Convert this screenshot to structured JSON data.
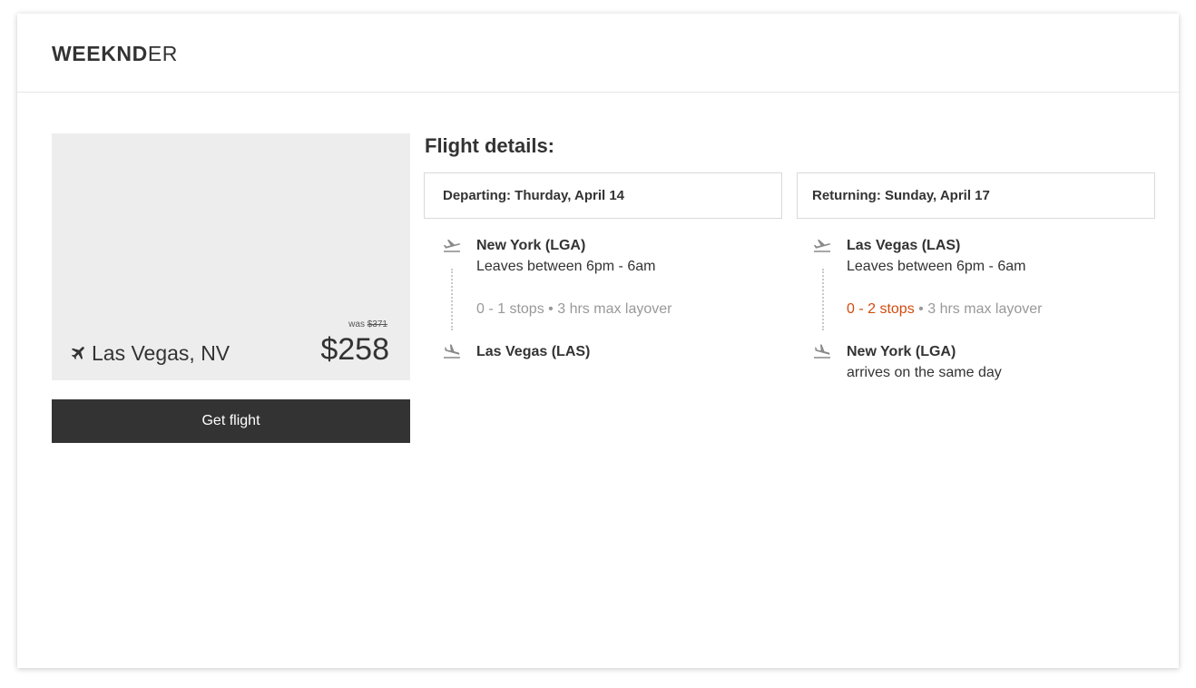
{
  "brand": {
    "logo_bold": "WEEKND",
    "logo_light": "ER"
  },
  "destination": {
    "icon": "airplane-icon",
    "name": "Las Vegas, NV",
    "was_label": "was",
    "was_price": "$371",
    "price": "$258",
    "cta_label": "Get flight"
  },
  "details": {
    "title": "Flight details:",
    "departing": {
      "header": "Departing: Thurday, April 14",
      "origin": "New York (LGA)",
      "leaves": "Leaves between 6pm - 6am",
      "stops": "0 - 1 stops",
      "separator": "•",
      "layover": "3 hrs max layover",
      "destination": "Las Vegas (LAS)"
    },
    "returning": {
      "header": "Returning: Sunday, April 17",
      "origin": "Las Vegas (LAS)",
      "leaves": "Leaves between 6pm - 6am",
      "stops": "0 - 2 stops",
      "separator": "•",
      "layover": "3 hrs max layover",
      "destination": "New York (LGA)",
      "arrival_note": "arrives on the same day"
    }
  },
  "colors": {
    "dark": "#333333",
    "panel": "#ededed",
    "muted": "#999999",
    "warning": "#d24b0f"
  }
}
